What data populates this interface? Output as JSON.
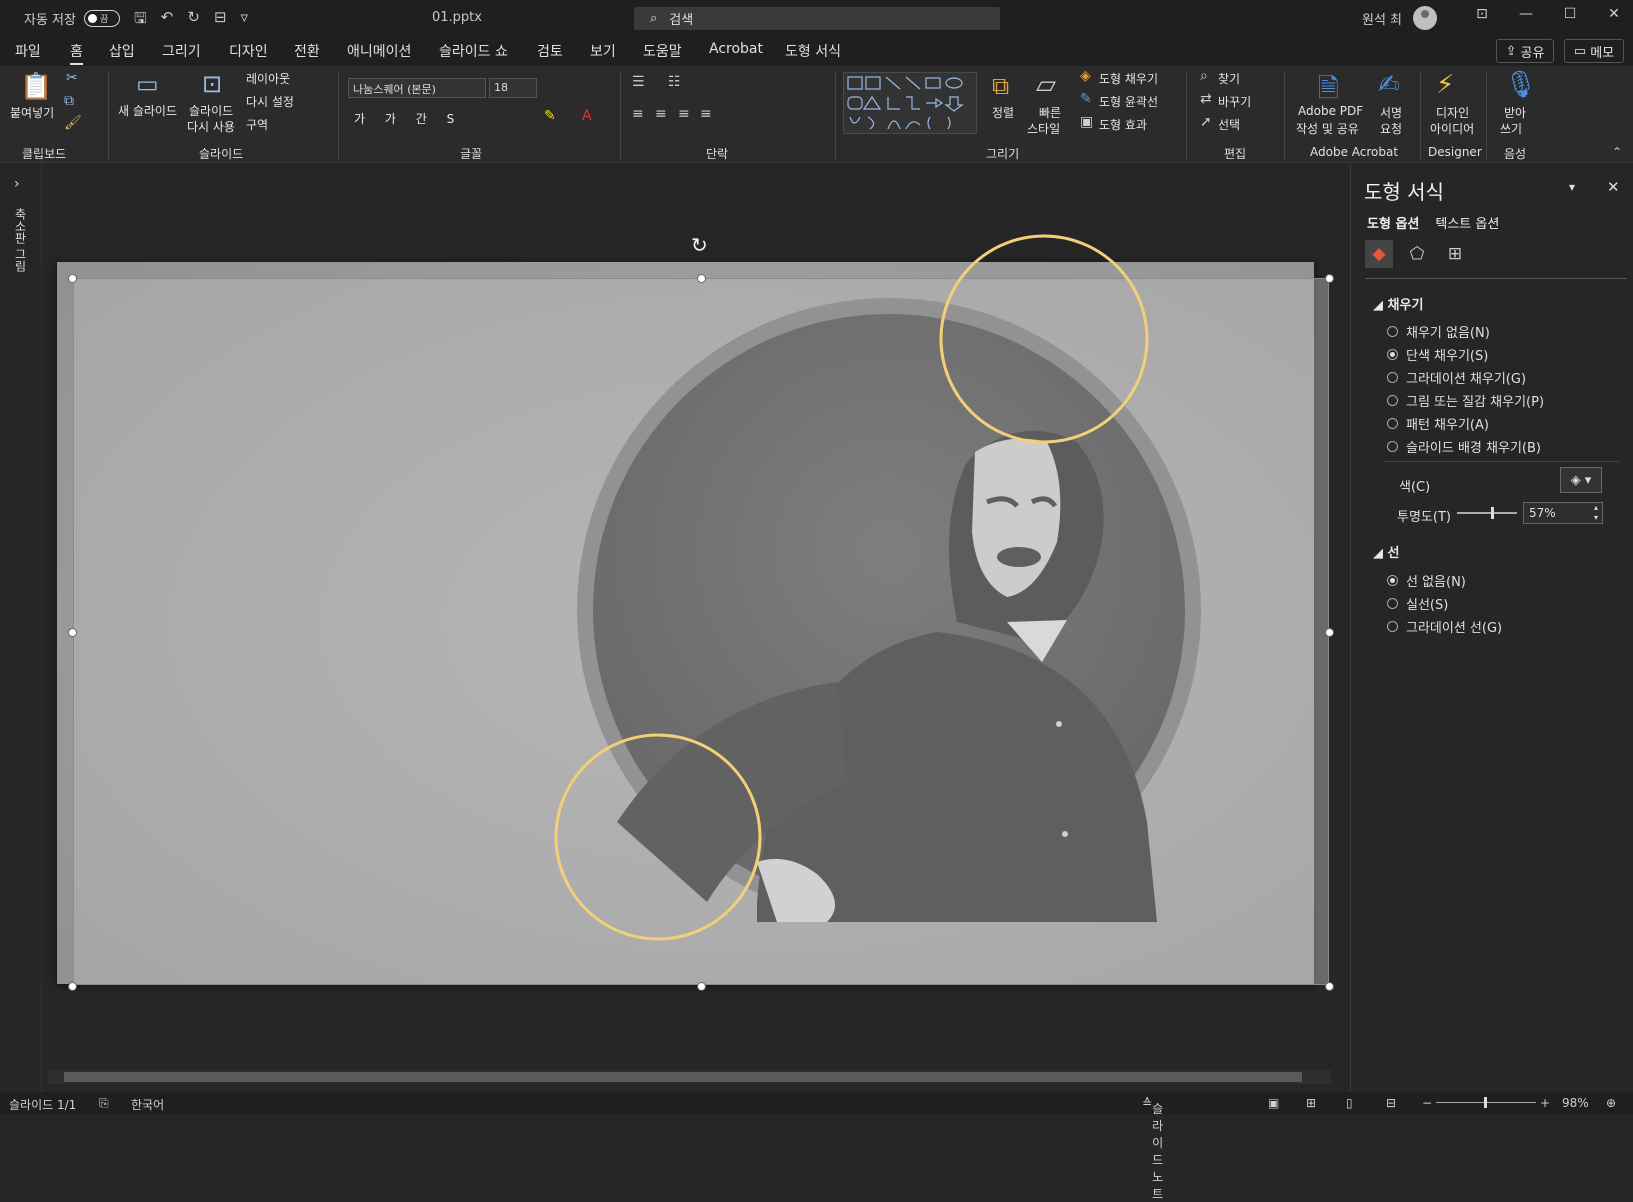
{
  "titlebar": {
    "autosave_label": "자동 저장",
    "autosave_state": "끔",
    "filename": "01.pptx",
    "search_placeholder": "검색",
    "user_name": "원석 최"
  },
  "menu": {
    "tabs": [
      "파일",
      "홈",
      "삽입",
      "그리기",
      "디자인",
      "전환",
      "애니메이션",
      "슬라이드 쇼",
      "검토",
      "보기",
      "도움말",
      "Acrobat",
      "도형 서식"
    ],
    "active_tab": "홈",
    "share_label": "공유",
    "memo_label": "메모"
  },
  "ribbon": {
    "clipboard": {
      "paste": "붙여넣기",
      "group": "클립보드"
    },
    "slides": {
      "new_slide": "새 슬라이드",
      "reuse1": "슬라이드",
      "reuse2": "다시 사용",
      "layout": "레이아웃",
      "reset": "다시 설정",
      "section": "구역",
      "group": "슬라이드"
    },
    "font": {
      "name": "나눔스퀘어 (본문)",
      "size": "18",
      "group": "글꼴"
    },
    "paragraph": {
      "group": "단락"
    },
    "drawing": {
      "arrange": "정렬",
      "quick1": "빠른",
      "quick2": "스타일",
      "fill": "도형 채우기",
      "outline": "도형 윤곽선",
      "effect": "도형 효과",
      "group": "그리기"
    },
    "editing": {
      "find": "찾기",
      "replace": "바꾸기",
      "select": "선택",
      "group": "편집"
    },
    "acrobat": {
      "pdf1": "Adobe PDF",
      "pdf2": "작성 및 공유",
      "sign1": "서명",
      "sign2": "요청",
      "group": "Adobe Acrobat"
    },
    "designer": {
      "label1": "디자인",
      "label2": "아이디어",
      "group": "Designer"
    },
    "voice": {
      "label1": "받아",
      "label2": "쓰기",
      "group": "음성"
    }
  },
  "leftbar": {
    "thumbnails_label": "축소판 그림"
  },
  "panel": {
    "title": "도형 서식",
    "tab_shape": "도형 옵션",
    "tab_text": "텍스트 옵션",
    "fill_header": "채우기",
    "fill_options": [
      "채우기 없음(N)",
      "단색 채우기(S)",
      "그라데이션 채우기(G)",
      "그림 또는 질감 채우기(P)",
      "패턴 채우기(A)",
      "슬라이드 배경 채우기(B)"
    ],
    "fill_selected": 1,
    "color_label": "색(C)",
    "transparency_label": "투명도(T)",
    "transparency_value": "57%",
    "transparency_fraction": 0.57,
    "line_header": "선",
    "line_options": [
      "선 없음(N)",
      "실선(S)",
      "그라데이션 선(G)"
    ],
    "line_selected": 0
  },
  "status": {
    "slide": "슬라이드 1/1",
    "language": "한국어",
    "notes": "슬라이드 노트",
    "zoom": "98%"
  },
  "colors": {
    "accent_circle": "#f3cf7a",
    "fill_icon": "#e8553d"
  }
}
